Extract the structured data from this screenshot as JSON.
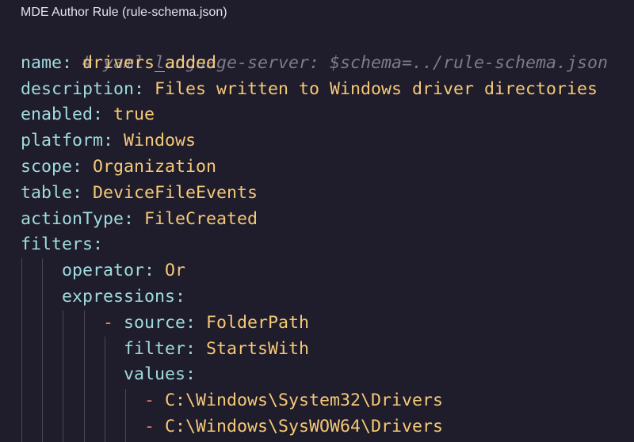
{
  "window": {
    "title": "MDE Author Rule (rule-schema.json)"
  },
  "editor": {
    "comment": "# yaml-language-server: $schema=../rule-schema.json",
    "lines": [
      {
        "key": "name",
        "value": "drivers_added"
      },
      {
        "key": "description",
        "value": "Files written to Windows driver directories"
      },
      {
        "key": "enabled",
        "value": "true"
      },
      {
        "key": "platform",
        "value": "Windows"
      },
      {
        "key": "scope",
        "value": "Organization"
      },
      {
        "key": "table",
        "value": "DeviceFileEvents"
      },
      {
        "key": "actionType",
        "value": "FileCreated"
      },
      {
        "key": "filters",
        "value": ""
      },
      {
        "key": "operator",
        "value": "Or"
      },
      {
        "key": "expressions",
        "value": ""
      },
      {
        "key": "source",
        "value": "FolderPath"
      },
      {
        "key": "filter",
        "value": "StartsWith"
      },
      {
        "key": "values",
        "value": ""
      }
    ],
    "list_values": [
      "C:\\Windows\\System32\\Drivers",
      "C:\\Windows\\SysWOW64\\Drivers"
    ]
  },
  "colors": {
    "background": "#1f1c2b",
    "key": "#9fdcdd",
    "value": "#f5c977",
    "comment": "#7f7a8e",
    "dash": "#e07e6b"
  }
}
